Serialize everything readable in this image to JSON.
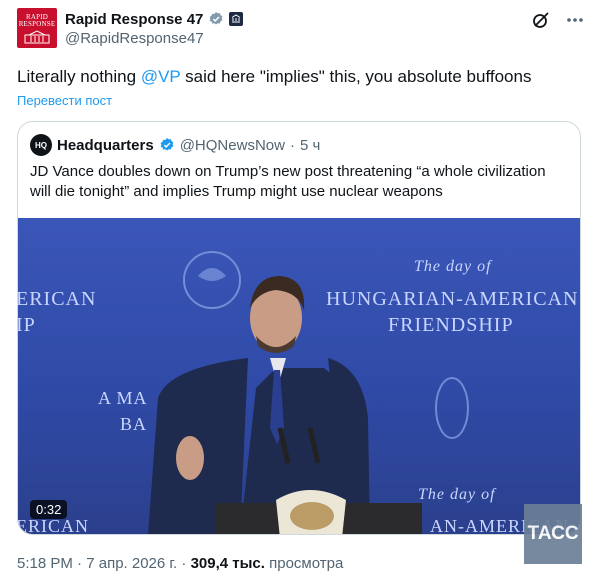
{
  "author": {
    "avatar_text": "RAPID\nRESPONSE",
    "display_name": "Rapid Response 47",
    "handle": "@RapidResponse47"
  },
  "tweet": {
    "text_before": "Literally nothing ",
    "mention": "@VP",
    "text_after": " said here \"implies\" this, you absolute buffoons",
    "translate_label": "Перевести пост"
  },
  "quoted": {
    "logo_text": "HQ",
    "display_name": "Headquarters",
    "handle": "@HQNewsNow",
    "separator": "·",
    "time": "5 ч",
    "text": "JD Vance doubles down on Trump’s new post threatening “a whole civilization will die tonight” and implies Trump might use nuclear weapons",
    "video": {
      "duration": "0:32",
      "backdrop_left_1": "ERICAN",
      "backdrop_left_2": "IP",
      "backdrop_script_1": "The day of",
      "backdrop_main_1": "HUNGARIAN-AMERICAN",
      "backdrop_main_2": "FRIENDSHIP",
      "backdrop_mid_1": "A MA",
      "backdrop_mid_2": "BA",
      "backdrop_script_2": "The day of",
      "backdrop_bottom_left": "ERICAN",
      "backdrop_bottom_right": "AN-AMERICAN"
    }
  },
  "footer": {
    "time": "5:18 PM",
    "separator": "·",
    "date": "7 апр. 2026 г.",
    "views_count": "309,4 тыс.",
    "views_label": "просмотра"
  },
  "watermark": "ТАСС",
  "icons": [
    "verified-badge-icon",
    "government-badge-icon",
    "grok-icon",
    "more-icon"
  ],
  "colors": {
    "accent": "#1d9bf0",
    "brand_red": "#c8102e",
    "video_blue": "#3a56b8"
  }
}
